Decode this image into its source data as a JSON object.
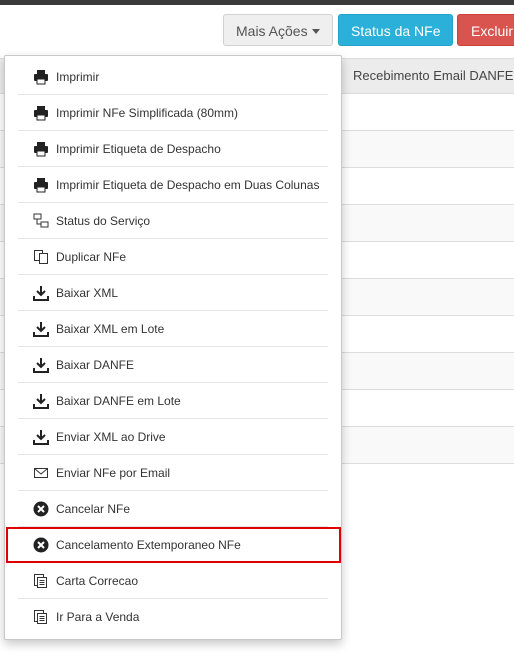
{
  "toolbar": {
    "more_actions_label": "Mais Ações",
    "status_label": "Status da NFe",
    "delete_label": "Excluir"
  },
  "table": {
    "visible_header": "Recebimento Email DANFE"
  },
  "menu": {
    "items": [
      {
        "label": "Imprimir",
        "icon": "printer-icon"
      },
      {
        "label": "Imprimir NFe Simplificada (80mm)",
        "icon": "printer-icon"
      },
      {
        "label": "Imprimir Etiqueta de Despacho",
        "icon": "printer-icon"
      },
      {
        "label": "Imprimir Etiqueta de Despacho em Duas Colunas",
        "icon": "printer-icon"
      },
      {
        "label": "Status do Serviço",
        "icon": "network-icon"
      },
      {
        "label": "Duplicar NFe",
        "icon": "duplicate-icon"
      },
      {
        "label": "Baixar XML",
        "icon": "download-icon"
      },
      {
        "label": "Baixar XML em Lote",
        "icon": "download-icon"
      },
      {
        "label": "Baixar DANFE",
        "icon": "download-icon"
      },
      {
        "label": "Baixar DANFE em Lote",
        "icon": "download-icon"
      },
      {
        "label": "Enviar XML ao Drive",
        "icon": "download-icon"
      },
      {
        "label": "Enviar NFe por Email",
        "icon": "envelope-icon"
      },
      {
        "label": "Cancelar NFe",
        "icon": "cancel-circle-icon"
      },
      {
        "label": "Cancelamento Extemporaneo NFe",
        "icon": "cancel-circle-icon"
      },
      {
        "label": "Carta Correcao",
        "icon": "document-copy-icon"
      },
      {
        "label": "Ir Para a Venda",
        "icon": "document-copy-icon"
      }
    ]
  },
  "colors": {
    "status_button": "#2bb1d9",
    "delete_button": "#d9534f",
    "highlight_border": "#e00000"
  }
}
